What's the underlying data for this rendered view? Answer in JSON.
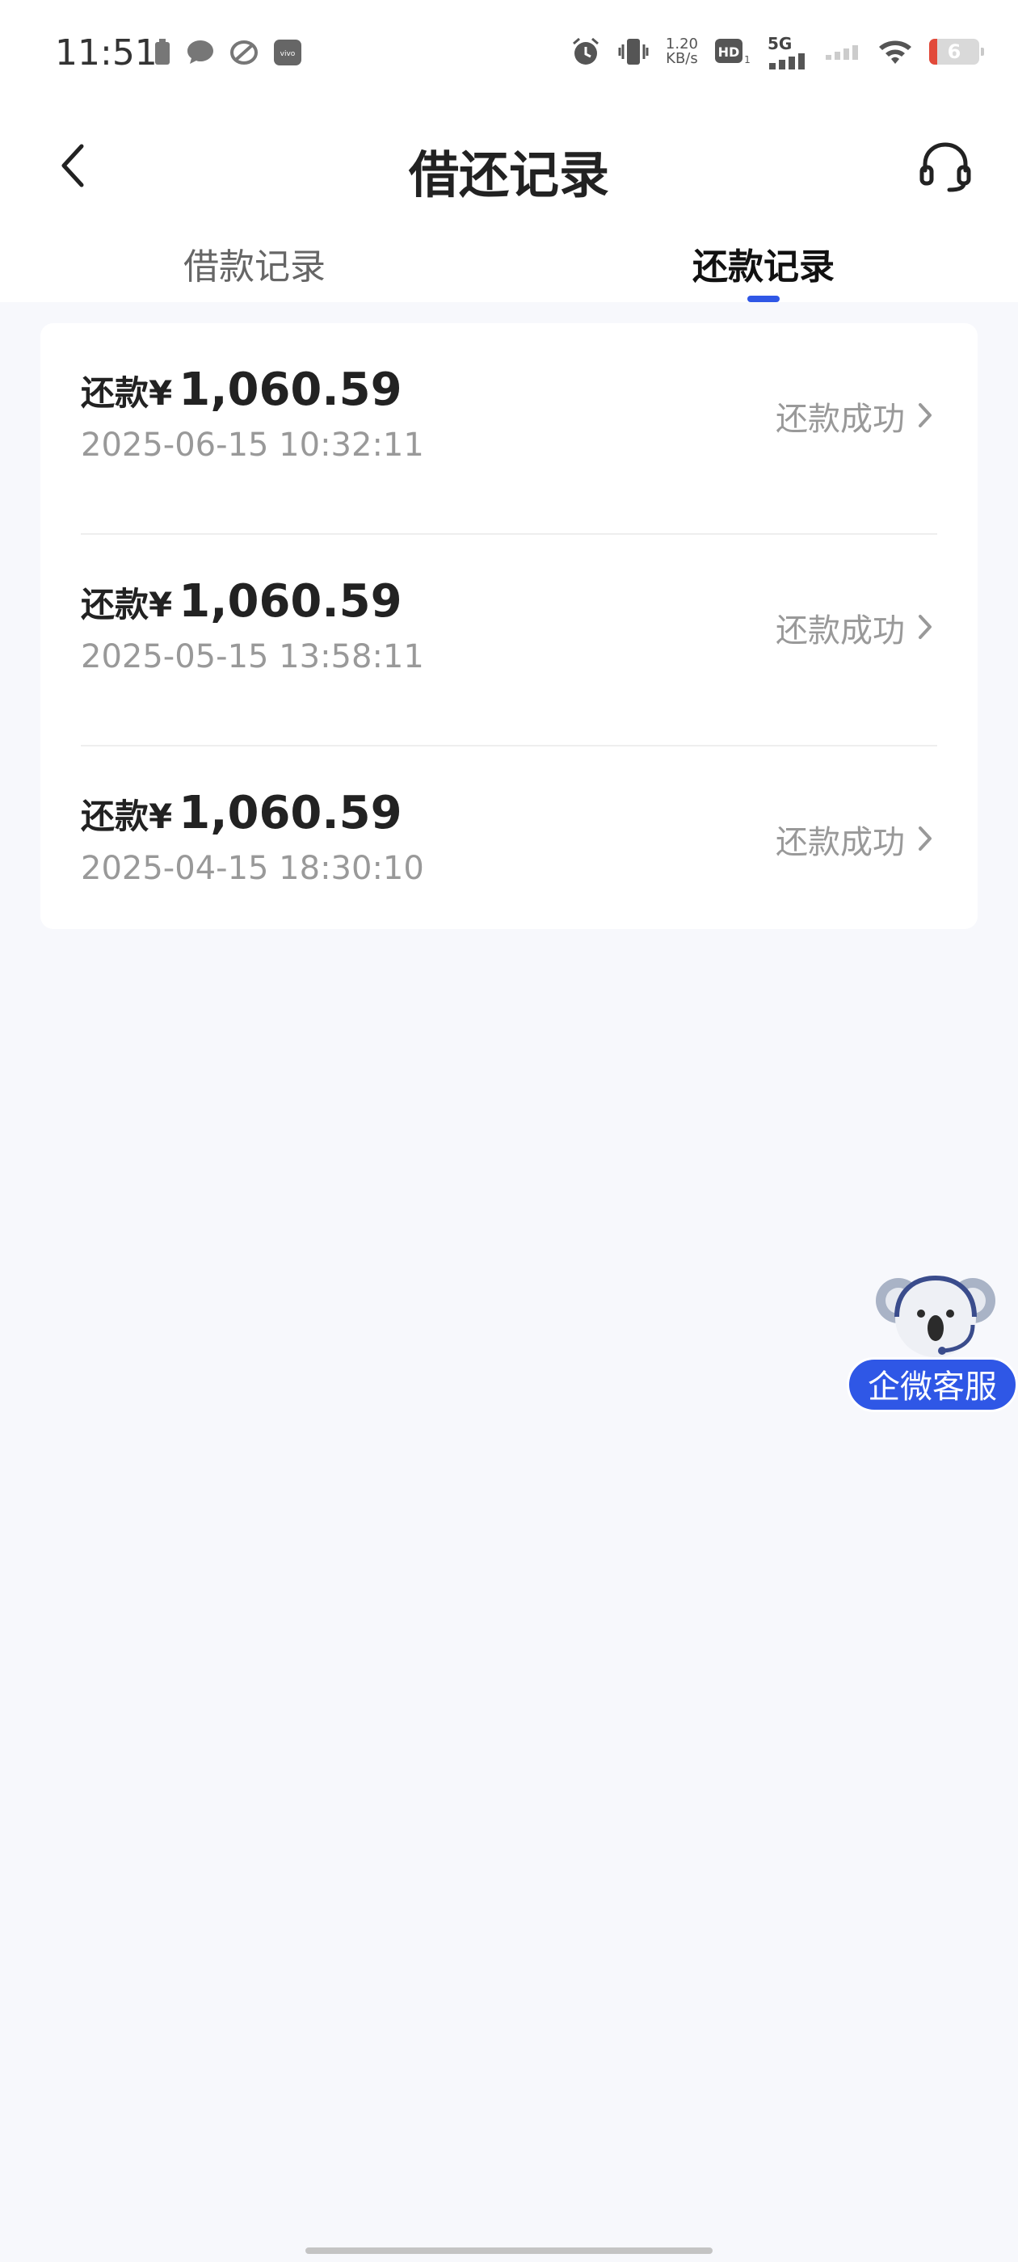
{
  "status_bar": {
    "time": "11:51",
    "speed": "1.20",
    "speed_unit": "KB/s",
    "hd_label": "HD",
    "network": "5G",
    "battery": "6",
    "notification_icons": [
      "battery-saver-icon",
      "message-icon",
      "app-icon",
      "vivo-icon"
    ],
    "system_icons": [
      "alarm-icon",
      "vibrate-icon",
      "signal-icon",
      "wifi-icon"
    ]
  },
  "header": {
    "title": "借还记录",
    "back_icon": "chevron-left-icon",
    "service_icon": "headset-icon"
  },
  "tabs": [
    {
      "label": "借款记录",
      "active": false
    },
    {
      "label": "还款记录",
      "active": true
    }
  ],
  "records": [
    {
      "prefix": "还款¥",
      "amount": "1,060.59",
      "time": "2025-06-15 10:32:11",
      "status": "还款成功"
    },
    {
      "prefix": "还款¥",
      "amount": "1,060.59",
      "time": "2025-05-15 13:58:11",
      "status": "还款成功"
    },
    {
      "prefix": "还款¥",
      "amount": "1,060.59",
      "time": "2025-04-15 18:30:10",
      "status": "还款成功"
    }
  ],
  "float_service": {
    "label": "企微客服",
    "mascot_icon": "koala-icon"
  },
  "colors": {
    "accent": "#2f57e6",
    "background": "#f7f8fc",
    "muted_text": "#999999"
  }
}
